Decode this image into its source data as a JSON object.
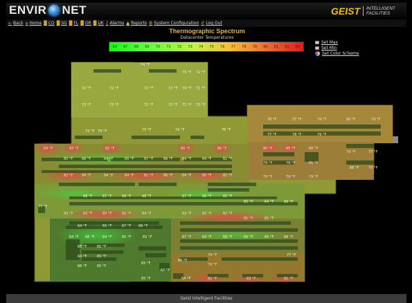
{
  "header": {
    "logo_part1": "ENVIR",
    "logo_part2": "NET",
    "brand_name": "GEIST",
    "brand_sub": "INTELLIGENT FACILITIES"
  },
  "nav": [
    {
      "icon": "back-icon",
      "label": "Back"
    },
    {
      "icon": "home-icon",
      "label": "Home"
    },
    {
      "icon": "bar-chart-icon",
      "label": "CO"
    },
    {
      "icon": "bar-chart-icon",
      "label": "SG"
    },
    {
      "icon": "bar-chart-icon",
      "label": "FL"
    },
    {
      "icon": "bar-chart-icon",
      "label": "OR"
    },
    {
      "icon": "bar-chart-icon",
      "label": "UK"
    },
    {
      "icon": "alarm-bell-icon",
      "label": "Alarms"
    },
    {
      "icon": "reports-icon",
      "label": "Reports"
    },
    {
      "icon": "config-icon",
      "label": "System Configuration"
    },
    {
      "icon": "key-icon",
      "label": "Log Out"
    }
  ],
  "title": "Thermographic Spectrum",
  "subtitle": "Datacenter Temperatures",
  "scale_ticks": [
    "64",
    "67",
    "68",
    "69",
    "70",
    "71",
    "72",
    "73",
    "74",
    "75",
    "76",
    "77",
    "78",
    "79",
    "80",
    "81",
    "82",
    "83"
  ],
  "controls": [
    {
      "name": "set-max-link",
      "icon": "set-max-icon",
      "label": "Set Max"
    },
    {
      "name": "set-min-link",
      "icon": "set-min-icon",
      "label": "Set Min"
    },
    {
      "name": "set-color-scheme-link",
      "icon": "color-scheme-icon",
      "label": "Set Color Scheme"
    }
  ],
  "temps": {
    "r1": [
      "74 °F"
    ],
    "r2": [
      "73 °F",
      "72 °F"
    ],
    "r3": [
      "72 °F",
      "72 °F",
      "72 °F",
      "73 °F",
      "74 °F",
      "71 °F"
    ],
    "r4": [
      "73 °F",
      "73 °F",
      "71 °F",
      "73 °F",
      "71 °F",
      "73 °F"
    ],
    "r5": [
      "76 °F",
      "77 °F",
      "79 °F",
      "80 °F",
      "79 °F"
    ],
    "r6": [
      "73 °F",
      "74 °F",
      "75 °F",
      "74 °F",
      "76 °F"
    ],
    "r7": [
      "77 °F",
      "78 °F",
      "79 °F"
    ],
    "r8": [
      "84 °F",
      "83 °F",
      "82 °F",
      "85 °F",
      "86 °F",
      "80 °F",
      "85 °F",
      "80 °F",
      "79 °F",
      "77 °F"
    ],
    "r9": [
      "65 °F",
      "66 °F",
      "64 °F",
      "65 °F",
      "67 °F",
      "66 °F",
      "64 °F",
      "64 °F",
      "61 °F"
    ],
    "r10": [
      "79 °F",
      "79 °F",
      "81 °F",
      "68 °F",
      "79 °F"
    ],
    "r11": [
      "82 °F",
      "84 °F",
      "84 °F",
      "84 °F",
      "81 °F",
      "86 °F",
      "84 °F",
      "85 °F",
      "81 °F"
    ],
    "r12": [
      "79 °F",
      "79 °F",
      "79 °F"
    ],
    "r13": [
      "68 °F",
      "67 °F",
      "68 °F",
      "66 °F",
      "67 °F",
      "66 °F",
      "65 °F",
      "65 °F",
      "64 °F",
      "66 °F"
    ],
    "r14": [
      "77 °F"
    ],
    "r15": [
      "83 °F",
      "83 °F",
      "82 °F",
      "82 °F",
      "84 °F",
      "83 °F",
      "82 °F",
      "82 °F",
      "81 °F",
      "81 °F"
    ],
    "r16": [
      "64 °F",
      "65 °F",
      "67 °F",
      "66 °F"
    ],
    "r17": [
      "64 °F",
      "66 °F",
      "64 °F",
      "65 °F",
      "65 °F",
      "67 °F",
      "64 °F",
      "66 °F",
      "65 °F",
      "65 °F",
      "66 °F"
    ],
    "r18": [
      "65 °F",
      "65 °F",
      "79 °F",
      "77 °F"
    ],
    "r19": [
      "64 °F",
      "65 °F",
      "65 °F",
      "66 °F",
      "79 °F"
    ],
    "r20": [
      "66 °F",
      "65 °F",
      "67 °F"
    ],
    "r21": [
      "65 °F",
      "64 °F",
      "82 °F",
      "83 °F",
      "81 °F"
    ]
  },
  "footer": "Geist Intelligent Facilities"
}
